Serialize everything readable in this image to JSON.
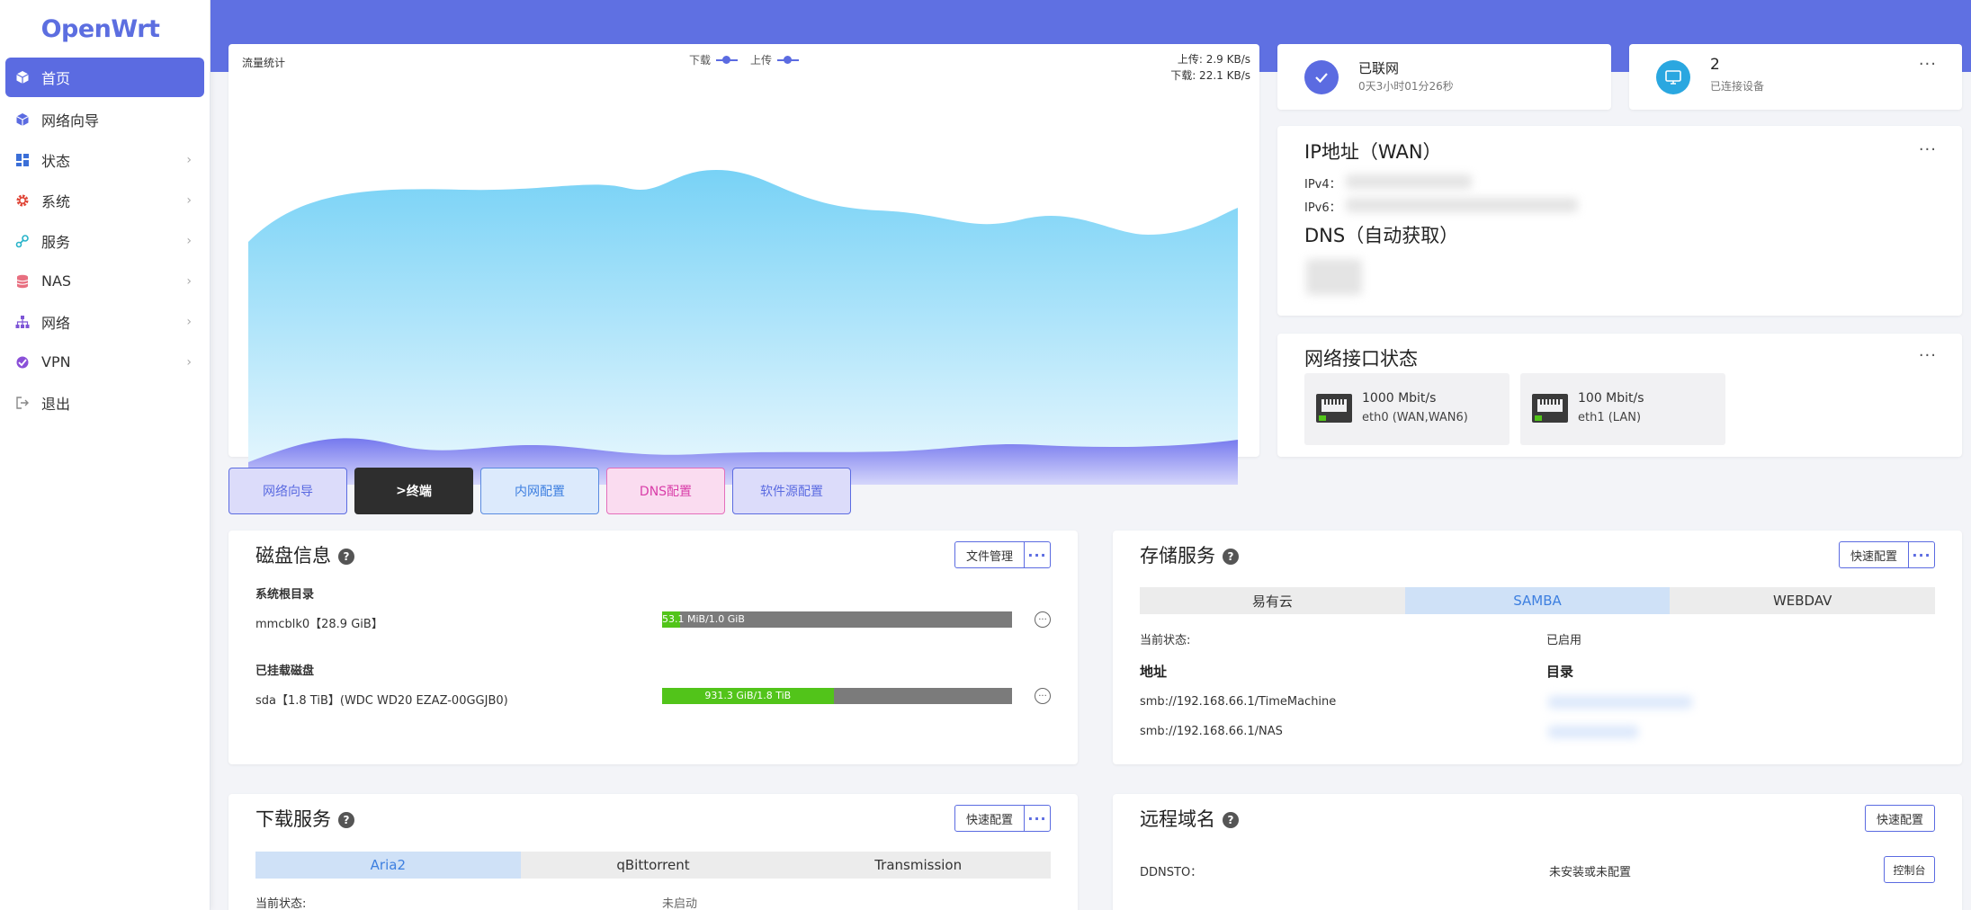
{
  "app": {
    "logo": "OpenWrt"
  },
  "sidebar": {
    "items": [
      {
        "label": "首页",
        "icon": "cube-icon"
      },
      {
        "label": "网络向导",
        "icon": "cube-icon"
      },
      {
        "label": "状态",
        "icon": "dashboard-icon"
      },
      {
        "label": "系统",
        "icon": "gear-icon"
      },
      {
        "label": "服务",
        "icon": "services-icon"
      },
      {
        "label": "NAS",
        "icon": "database-icon"
      },
      {
        "label": "网络",
        "icon": "network-icon"
      },
      {
        "label": "VPN",
        "icon": "vpn-icon"
      },
      {
        "label": "退出",
        "icon": "logout-icon"
      }
    ]
  },
  "traffic": {
    "title": "流量统计",
    "legend_down": "下载",
    "legend_up": "上传",
    "upload_rate": "上传: 2.9 KB/s",
    "download_rate": "下载: 22.1 KB/s",
    "colors": {
      "download": "#7fd5f6",
      "upload": "#7b7ef0"
    }
  },
  "quick_buttons": [
    {
      "label": "网络向导"
    },
    {
      "label": "终端",
      "prefix": ">"
    },
    {
      "label": "内网配置"
    },
    {
      "label": "DNS配置"
    },
    {
      "label": "软件源配置"
    }
  ],
  "status": {
    "connected_title": "已联网",
    "connected_uptime": "0天3小时01分26秒",
    "devices_count": "2",
    "devices_label": "已连接设备"
  },
  "ip": {
    "title": "IP地址（WAN）",
    "ipv4_label": "IPv4：",
    "ipv6_label": "IPv6：",
    "dns_title": "DNS（自动获取）"
  },
  "interfaces": {
    "title": "网络接口状态",
    "items": [
      {
        "speed": "1000 Mbit/s",
        "name": "eth0 (WAN,WAN6)"
      },
      {
        "speed": "100 Mbit/s",
        "name": "eth1 (LAN)"
      }
    ]
  },
  "disk": {
    "title": "磁盘信息",
    "file_manager": "文件管理",
    "root_heading": "系统根目录",
    "root_name": "mmcblk0【28.9 GiB】",
    "root_usage": "53.1 MiB/1.0 GiB",
    "root_fraction": 0.052,
    "mounted_heading": "已挂载磁盘",
    "mounted_name": "sda【1.8 TiB】(WDC WD20 EZAZ-00GGJB0)",
    "mounted_usage": "931.3 GiB/1.8 TiB",
    "mounted_fraction": 0.49
  },
  "storage": {
    "title": "存储服务",
    "quick_config": "快速配置",
    "tabs": [
      "易有云",
      "SAMBA",
      "WEBDAV"
    ],
    "status_label": "当前状态:",
    "status_value": "已启用",
    "addr_header": "地址",
    "dir_header": "目录",
    "addresses": [
      "smb://192.168.66.1/TimeMachine",
      "smb://192.168.66.1/NAS"
    ]
  },
  "download": {
    "title": "下载服务",
    "quick_config": "快速配置",
    "tabs": [
      "Aria2",
      "qBittorrent",
      "Transmission"
    ],
    "status_label": "当前状态:",
    "status_value": "未启动"
  },
  "remote": {
    "title": "远程域名",
    "quick_config": "快速配置",
    "ddnsto_label": "DDNSTO：",
    "ddnsto_status": "未安装或未配置",
    "console": "控制台"
  }
}
